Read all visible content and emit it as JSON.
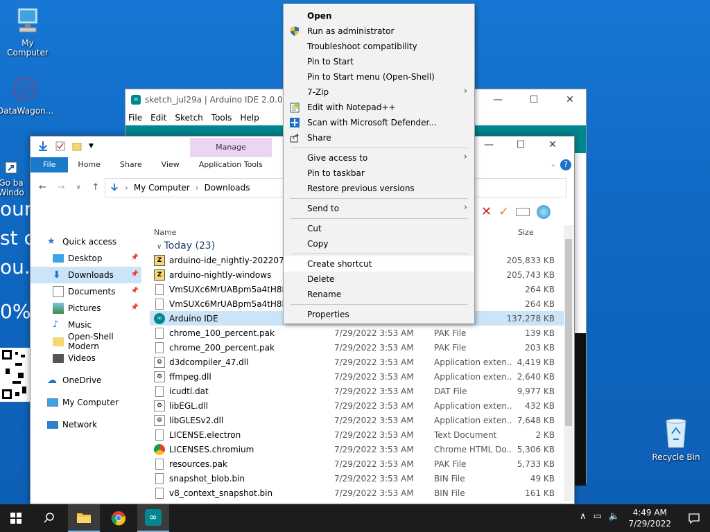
{
  "desktop": {
    "icons": {
      "my_computer": "My Computer",
      "datawagon": "DataWagon...",
      "goback_line1": "Go ba",
      "goback_line2": "Windo",
      "recycle_bin": "Recycle Bin"
    },
    "bg_text": [
      "our",
      "st c",
      "ou.",
      "0%"
    ]
  },
  "arduino": {
    "title": "sketch_jul29a | Arduino IDE 2.0.0-rc9-n",
    "menu": [
      "File",
      "Edit",
      "Sketch",
      "Tools",
      "Help"
    ],
    "accent": "#00878f"
  },
  "explorer": {
    "manage_label": "Manage",
    "tabs": [
      "File",
      "Home",
      "Share",
      "View",
      "Application Tools"
    ],
    "breadcrumb": [
      "My Computer",
      "Downloads"
    ],
    "nav": [
      {
        "label": "Quick access",
        "icon": "star-icon"
      },
      {
        "label": "Desktop",
        "icon": "desktop-icon",
        "pinned": true
      },
      {
        "label": "Downloads",
        "icon": "download-icon",
        "pinned": true
      },
      {
        "label": "Documents",
        "icon": "document-icon",
        "pinned": true
      },
      {
        "label": "Pictures",
        "icon": "picture-icon",
        "pinned": true
      },
      {
        "label": "Music",
        "icon": "music-icon"
      },
      {
        "label": "Open-Shell Modern",
        "icon": "folder-icon"
      },
      {
        "label": "Videos",
        "icon": "video-icon"
      },
      {
        "label": "OneDrive",
        "icon": "cloud-icon"
      },
      {
        "label": "My Computer",
        "icon": "computer-icon"
      },
      {
        "label": "Network",
        "icon": "network-icon"
      }
    ],
    "columns": {
      "name": "Name",
      "size": "Size"
    },
    "group": "Today (23)",
    "files": [
      {
        "name": "arduino-ide_nightly-20220729_V",
        "date": "",
        "type": "",
        "size": "205,833 KB"
      },
      {
        "name": "arduino-nightly-windows",
        "date": "",
        "type": "",
        "size": "205,743 KB"
      },
      {
        "name": "VmSUXc6MrUABpm5a4tH8KK",
        "date": "",
        "type": "",
        "size": "264 KB"
      },
      {
        "name": "VmSUXc6MrUABpm5a4tH8KK",
        "date": "",
        "type": "",
        "size": "264 KB"
      },
      {
        "name": "Arduino IDE",
        "date": "",
        "type": "",
        "size": "137,278 KB"
      },
      {
        "name": "chrome_100_percent.pak",
        "date": "7/29/2022 3:53 AM",
        "type": "PAK File",
        "size": "139 KB"
      },
      {
        "name": "chrome_200_percent.pak",
        "date": "7/29/2022 3:53 AM",
        "type": "PAK File",
        "size": "203 KB"
      },
      {
        "name": "d3dcompiler_47.dll",
        "date": "7/29/2022 3:53 AM",
        "type": "Application exten...",
        "size": "4,419 KB"
      },
      {
        "name": "ffmpeg.dll",
        "date": "7/29/2022 3:53 AM",
        "type": "Application exten...",
        "size": "2,640 KB"
      },
      {
        "name": "icudtl.dat",
        "date": "7/29/2022 3:53 AM",
        "type": "DAT File",
        "size": "9,977 KB"
      },
      {
        "name": "libEGL.dll",
        "date": "7/29/2022 3:53 AM",
        "type": "Application exten...",
        "size": "432 KB"
      },
      {
        "name": "libGLESv2.dll",
        "date": "7/29/2022 3:53 AM",
        "type": "Application exten...",
        "size": "7,648 KB"
      },
      {
        "name": "LICENSE.electron",
        "date": "7/29/2022 3:53 AM",
        "type": "Text Document",
        "size": "2 KB"
      },
      {
        "name": "LICENSES.chromium",
        "date": "7/29/2022 3:53 AM",
        "type": "Chrome HTML Do...",
        "size": "5,306 KB"
      },
      {
        "name": "resources.pak",
        "date": "7/29/2022 3:53 AM",
        "type": "PAK File",
        "size": "5,733 KB"
      },
      {
        "name": "snapshot_blob.bin",
        "date": "7/29/2022 3:53 AM",
        "type": "BIN File",
        "size": "49 KB"
      },
      {
        "name": "v8_context_snapshot.bin",
        "date": "7/29/2022 3:53 AM",
        "type": "BIN File",
        "size": "161 KB"
      }
    ]
  },
  "context_menu": [
    {
      "label": "Open",
      "bold": true
    },
    {
      "label": "Run as administrator",
      "icon": "shield-icon"
    },
    {
      "label": "Troubleshoot compatibility"
    },
    {
      "label": "Pin to Start"
    },
    {
      "label": "Pin to Start menu (Open-Shell)"
    },
    {
      "label": "7-Zip",
      "submenu": true
    },
    {
      "label": "Edit with Notepad++",
      "icon": "notepad-icon"
    },
    {
      "label": "Scan with Microsoft Defender...",
      "icon": "defender-icon"
    },
    {
      "label": "Share",
      "icon": "share-icon"
    },
    {
      "sep": true
    },
    {
      "label": "Give access to",
      "submenu": true
    },
    {
      "label": "Pin to taskbar"
    },
    {
      "label": "Restore previous versions"
    },
    {
      "sep": true
    },
    {
      "label": "Send to",
      "submenu": true
    },
    {
      "sep": true
    },
    {
      "label": "Cut"
    },
    {
      "label": "Copy"
    },
    {
      "sep": true
    },
    {
      "label": "Create shortcut",
      "hover": true
    },
    {
      "label": "Delete"
    },
    {
      "label": "Rename"
    },
    {
      "sep": true
    },
    {
      "label": "Properties"
    }
  ],
  "taskbar": {
    "time": "4:49 AM",
    "date": "7/29/2022"
  }
}
